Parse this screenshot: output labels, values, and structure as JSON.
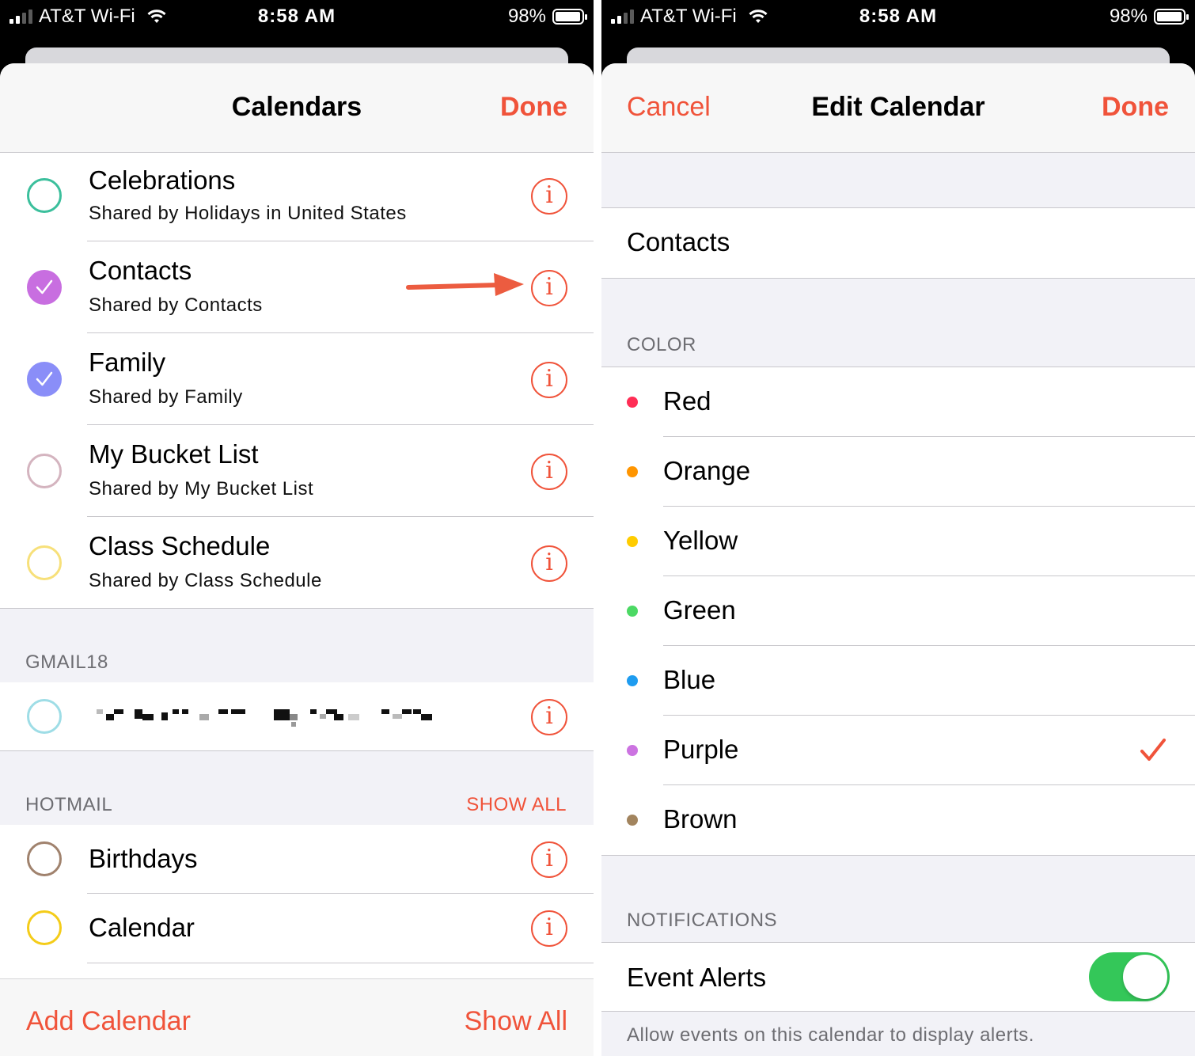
{
  "status_bar": {
    "carrier": "AT&T Wi-Fi",
    "time": "8:58 AM",
    "battery": "98%",
    "battery_level": 0.98
  },
  "left": {
    "nav": {
      "title": "Calendars",
      "done_label": "Done"
    },
    "calendars": [
      {
        "name": "Celebrations",
        "shared_by": "Shared by Holidays in United States",
        "color": "#3bbf9c",
        "checked": false
      },
      {
        "name": "Contacts",
        "shared_by": "Shared by Contacts",
        "color": "#c86ee0",
        "checked": true
      },
      {
        "name": "Family",
        "shared_by": "Shared by Family",
        "color": "#8a8ef8",
        "checked": true
      },
      {
        "name": "My Bucket List",
        "shared_by": "Shared by My Bucket List",
        "color": "#d4b4bf",
        "checked": false
      },
      {
        "name": "Class Schedule",
        "shared_by": "Shared by Class Schedule",
        "color": "#f7e07a",
        "checked": false
      }
    ],
    "gmail": {
      "header": "GMAIL18",
      "circle_color": "#9edde6"
    },
    "hotmail": {
      "header": "HOTMAIL",
      "show_all": "SHOW ALL",
      "calendars": [
        {
          "name": "Birthdays",
          "color": "#a0826d"
        },
        {
          "name": "Calendar",
          "color": "#f4cc19"
        }
      ]
    },
    "footer": {
      "add_calendar": "Add Calendar",
      "show_all": "Show All"
    },
    "info_glyph": "i",
    "accent_color": "#f0533a"
  },
  "right": {
    "nav": {
      "cancel_label": "Cancel",
      "title": "Edit Calendar",
      "done_label": "Done"
    },
    "calendar_name": "Contacts",
    "color_header": "COLOR",
    "colors": [
      {
        "name": "Red",
        "hex": "#ff2d55",
        "selected": false
      },
      {
        "name": "Orange",
        "hex": "#ff9500",
        "selected": false
      },
      {
        "name": "Yellow",
        "hex": "#ffcc00",
        "selected": false
      },
      {
        "name": "Green",
        "hex": "#4cd964",
        "selected": false
      },
      {
        "name": "Blue",
        "hex": "#1e9cf0",
        "selected": false
      },
      {
        "name": "Purple",
        "hex": "#cc73e1",
        "selected": true
      },
      {
        "name": "Brown",
        "hex": "#a2845e",
        "selected": false
      }
    ],
    "notifications_header": "NOTIFICATIONS",
    "event_alerts": {
      "label": "Event Alerts",
      "on": true
    },
    "footer_note": "Allow events on this calendar to display alerts."
  }
}
